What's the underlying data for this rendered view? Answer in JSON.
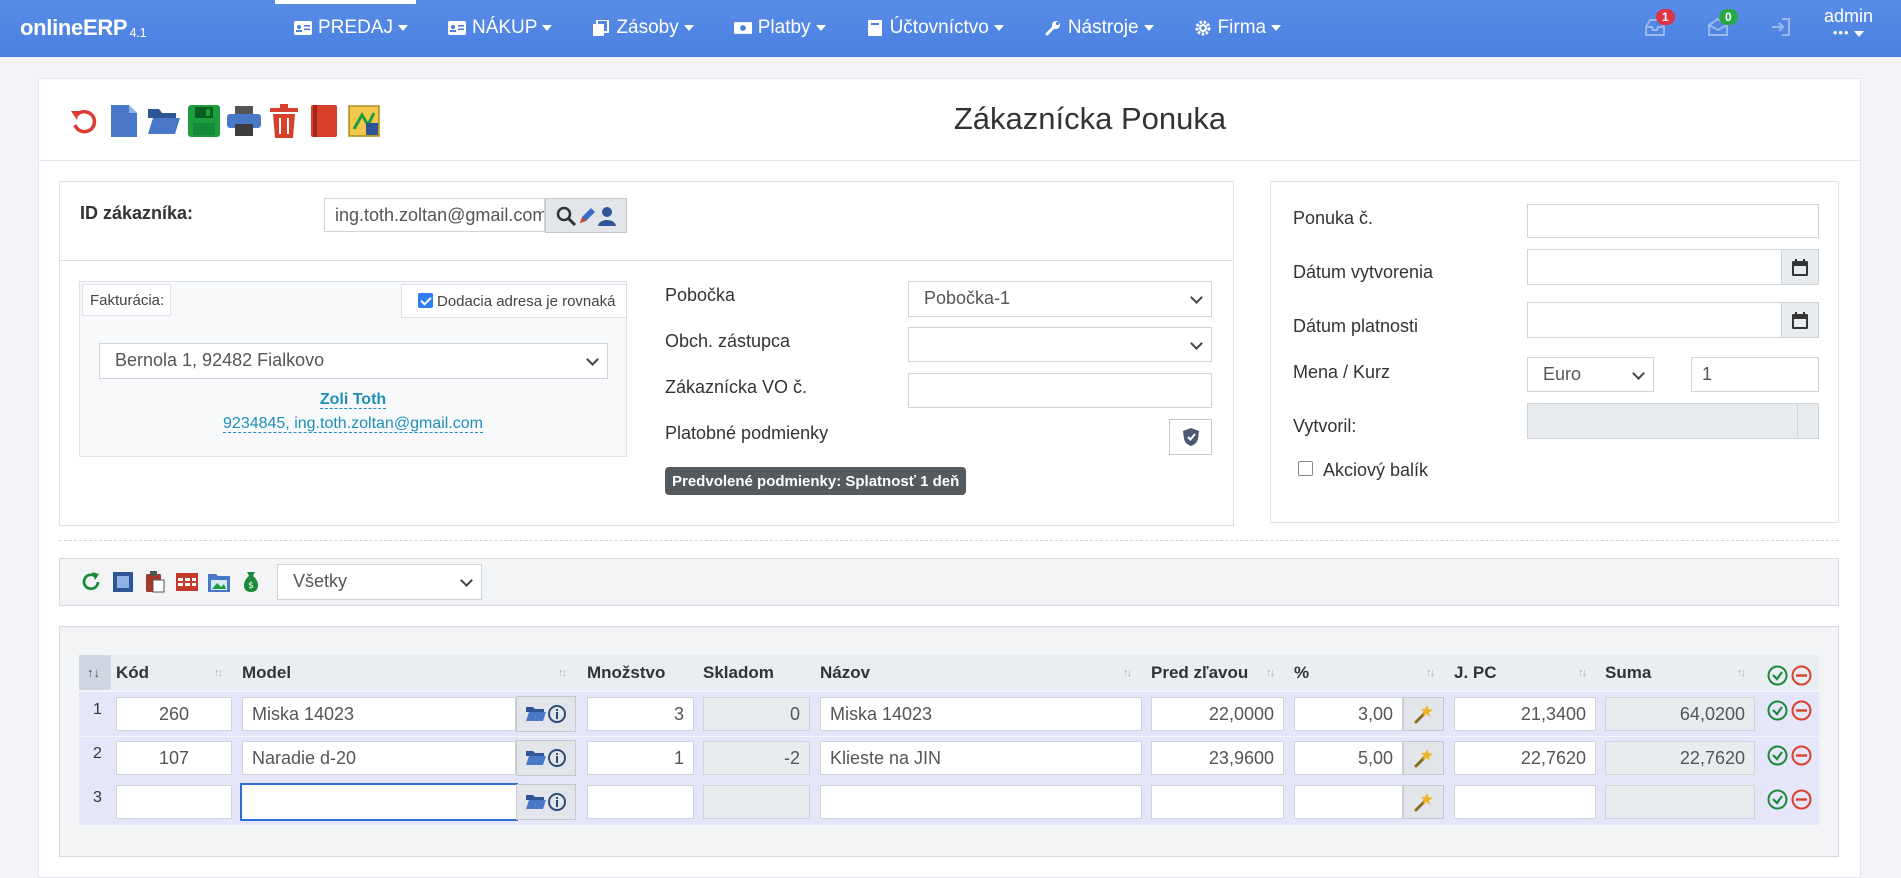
{
  "app": {
    "brand": "onlineERP",
    "version": "4.1"
  },
  "nav": {
    "items": [
      {
        "label": "PREDAJ",
        "icon": "id-card-icon"
      },
      {
        "label": "NÁKUP",
        "icon": "id-card-icon"
      },
      {
        "label": "Zásoby",
        "icon": "copy-icon"
      },
      {
        "label": "Platby",
        "icon": "money-icon"
      },
      {
        "label": "Účtovníctvo",
        "icon": "book-icon"
      },
      {
        "label": "Nástroje",
        "icon": "wrench-icon"
      },
      {
        "label": "Firma",
        "icon": "gear-icon"
      }
    ],
    "notifications_count": "1",
    "messages_count": "0",
    "user": "admin",
    "user_menu": "•••"
  },
  "page": {
    "title": "Zákaznícka Ponuka"
  },
  "toolbar": {
    "icons": [
      "undo-icon",
      "new-document-icon",
      "open-folder-icon",
      "save-icon",
      "print-icon",
      "delete-icon",
      "book-icon",
      "export-icon"
    ]
  },
  "customer": {
    "id_label": "ID zákazníka:",
    "id_value": "ing.toth.zoltan@gmail.com",
    "billing_tab": "Fakturácia:",
    "same_address_label": "Dodacia adresa je rovnaká",
    "same_address_checked": true,
    "address_value": "Bernola 1, 92482 Fialkovo",
    "contact_name": "Zoli Toth",
    "contact_info": "9234845, ing.toth.zoltan@gmail.com"
  },
  "details": {
    "branch_label": "Pobočka",
    "branch_value": "Pobočka-1",
    "rep_label": "Obch. zástupca",
    "rep_value": "",
    "order_label": "Zákaznícka VO č.",
    "order_value": "",
    "terms_label": "Platobné podmienky",
    "default_terms": "Predvolené podmienky: Splatnosť 1 deň"
  },
  "offer": {
    "number_label": "Ponuka č.",
    "number_value": "",
    "created_label": "Dátum vytvorenia",
    "created_value": "",
    "valid_label": "Dátum platnosti",
    "valid_value": "",
    "currency_label": "Mena / Kurz",
    "currency_value": "Euro",
    "rate_value": "1",
    "author_label": "Vytvoril:",
    "author_value": "",
    "bundle_label": "Akciový balík",
    "bundle_checked": false
  },
  "lines_toolbar": {
    "icons": [
      "refresh-icon",
      "select-all-icon",
      "paste-icon",
      "table-icon",
      "image-folder-icon",
      "money-bag-icon"
    ],
    "filter_value": "Všetky"
  },
  "table": {
    "columns": [
      "Kód",
      "Model",
      "Množstvo",
      "Skladom",
      "Názov",
      "Pred zľavou",
      "%",
      "J. PC",
      "Suma"
    ],
    "rows": [
      {
        "n": "1",
        "kod": "260",
        "model": "Miska 14023",
        "mnozstvo": "3",
        "skladom": "0",
        "nazov": "Miska 14023",
        "pred": "22,0000",
        "pct": "3,00",
        "jpc": "21,3400",
        "suma": "64,0200"
      },
      {
        "n": "2",
        "kod": "107",
        "model": "Naradie d-20",
        "mnozstvo": "1",
        "skladom": "-2",
        "nazov": "Klieste na JIN",
        "pred": "23,9600",
        "pct": "5,00",
        "jpc": "22,7620",
        "suma": "22,7620"
      },
      {
        "n": "3",
        "kod": "",
        "model": "",
        "mnozstvo": "",
        "skladom": "",
        "nazov": "",
        "pred": "",
        "pct": "",
        "jpc": "",
        "suma": ""
      }
    ]
  },
  "colors": {
    "nav": "#4a7fdf",
    "row": "#e6e6fa",
    "accent": "#2f7ef7",
    "badge_red": "#dc3545",
    "badge_green": "#28a745"
  }
}
